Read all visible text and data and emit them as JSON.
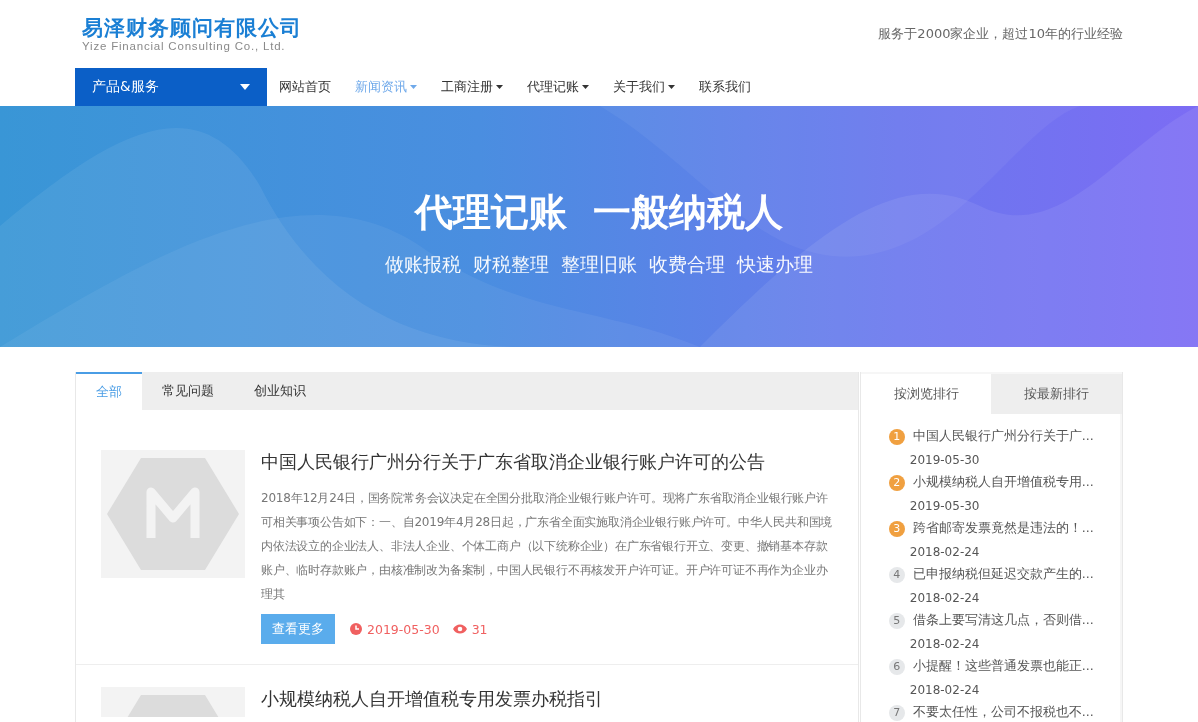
{
  "header": {
    "company_name": "易泽财务顾问有限公司",
    "company_name_en": "Yize Financial Consulting Co., Ltd.",
    "slogan": "服务于2000家企业，超过10年的行业经验"
  },
  "nav": {
    "menu_button": "产品&服务",
    "items": [
      {
        "label": "网站首页",
        "selected": false,
        "has_menu": false
      },
      {
        "label": "新闻资讯",
        "selected": true,
        "has_menu": true
      },
      {
        "label": "工商注册",
        "selected": false,
        "has_menu": true
      },
      {
        "label": "代理记账",
        "selected": false,
        "has_menu": true
      },
      {
        "label": "关于我们",
        "selected": false,
        "has_menu": true
      },
      {
        "label": "联系我们",
        "selected": false,
        "has_menu": false
      }
    ]
  },
  "banner": {
    "title": "代理记账  一般纳税人",
    "subtitle": "做账报税  财税整理  整理旧账  收费合理  快速办理"
  },
  "tabs": [
    {
      "label": "全部",
      "selected": true
    },
    {
      "label": "常见问题",
      "selected": false
    },
    {
      "label": "创业知识",
      "selected": false
    }
  ],
  "articles": [
    {
      "title": "中国人民银行广州分行关于广东省取消企业银行账户许可的公告",
      "summary": "2018年12月24日，国务院常务会议决定在全国分批取消企业银行账户许可。现将广东省取消企业银行账户许可相关事项公告如下：一、自2019年4月28日起，广东省全面实施取消企业银行账户许可。中华人民共和国境内依法设立的企业法人、非法人企业、个体工商户（以下统称企业）在广东省银行开立、变更、撤销基本存款账户、临时存款账户，由核准制改为备案制，中国人民银行不再核发开户许可证。开户许可证不再作为企业办理其",
      "button": "查看更多",
      "date": "2019-05-30",
      "views": "31"
    },
    {
      "title": "小规模纳税人自开增值税专用发票办税指引"
    }
  ],
  "ranking": {
    "tabs": [
      {
        "label": "按浏览排行",
        "selected": true
      },
      {
        "label": "按最新排行",
        "selected": false
      }
    ],
    "items": [
      {
        "rank": "1",
        "kind": "top",
        "title": "中国人民银行广州分行关于广...",
        "date": "2019-05-30"
      },
      {
        "rank": "2",
        "kind": "top",
        "title": "小规模纳税人自开增值税专用...",
        "date": "2019-05-30"
      },
      {
        "rank": "3",
        "kind": "top",
        "title": "跨省邮寄发票竟然是违法的！...",
        "date": "2018-02-24"
      },
      {
        "rank": "4",
        "kind": "normal",
        "title": "已申报纳税但延迟交款产生的...",
        "date": "2018-02-24"
      },
      {
        "rank": "5",
        "kind": "normal",
        "title": "借条上要写清这几点，否则借...",
        "date": "2018-02-24"
      },
      {
        "rank": "6",
        "kind": "normal",
        "title": "小提醒！这些普通发票也能正...",
        "date": "2018-02-24"
      },
      {
        "rank": "7",
        "kind": "normal",
        "title": "不要太任性，公司不报税也不..."
      }
    ]
  }
}
